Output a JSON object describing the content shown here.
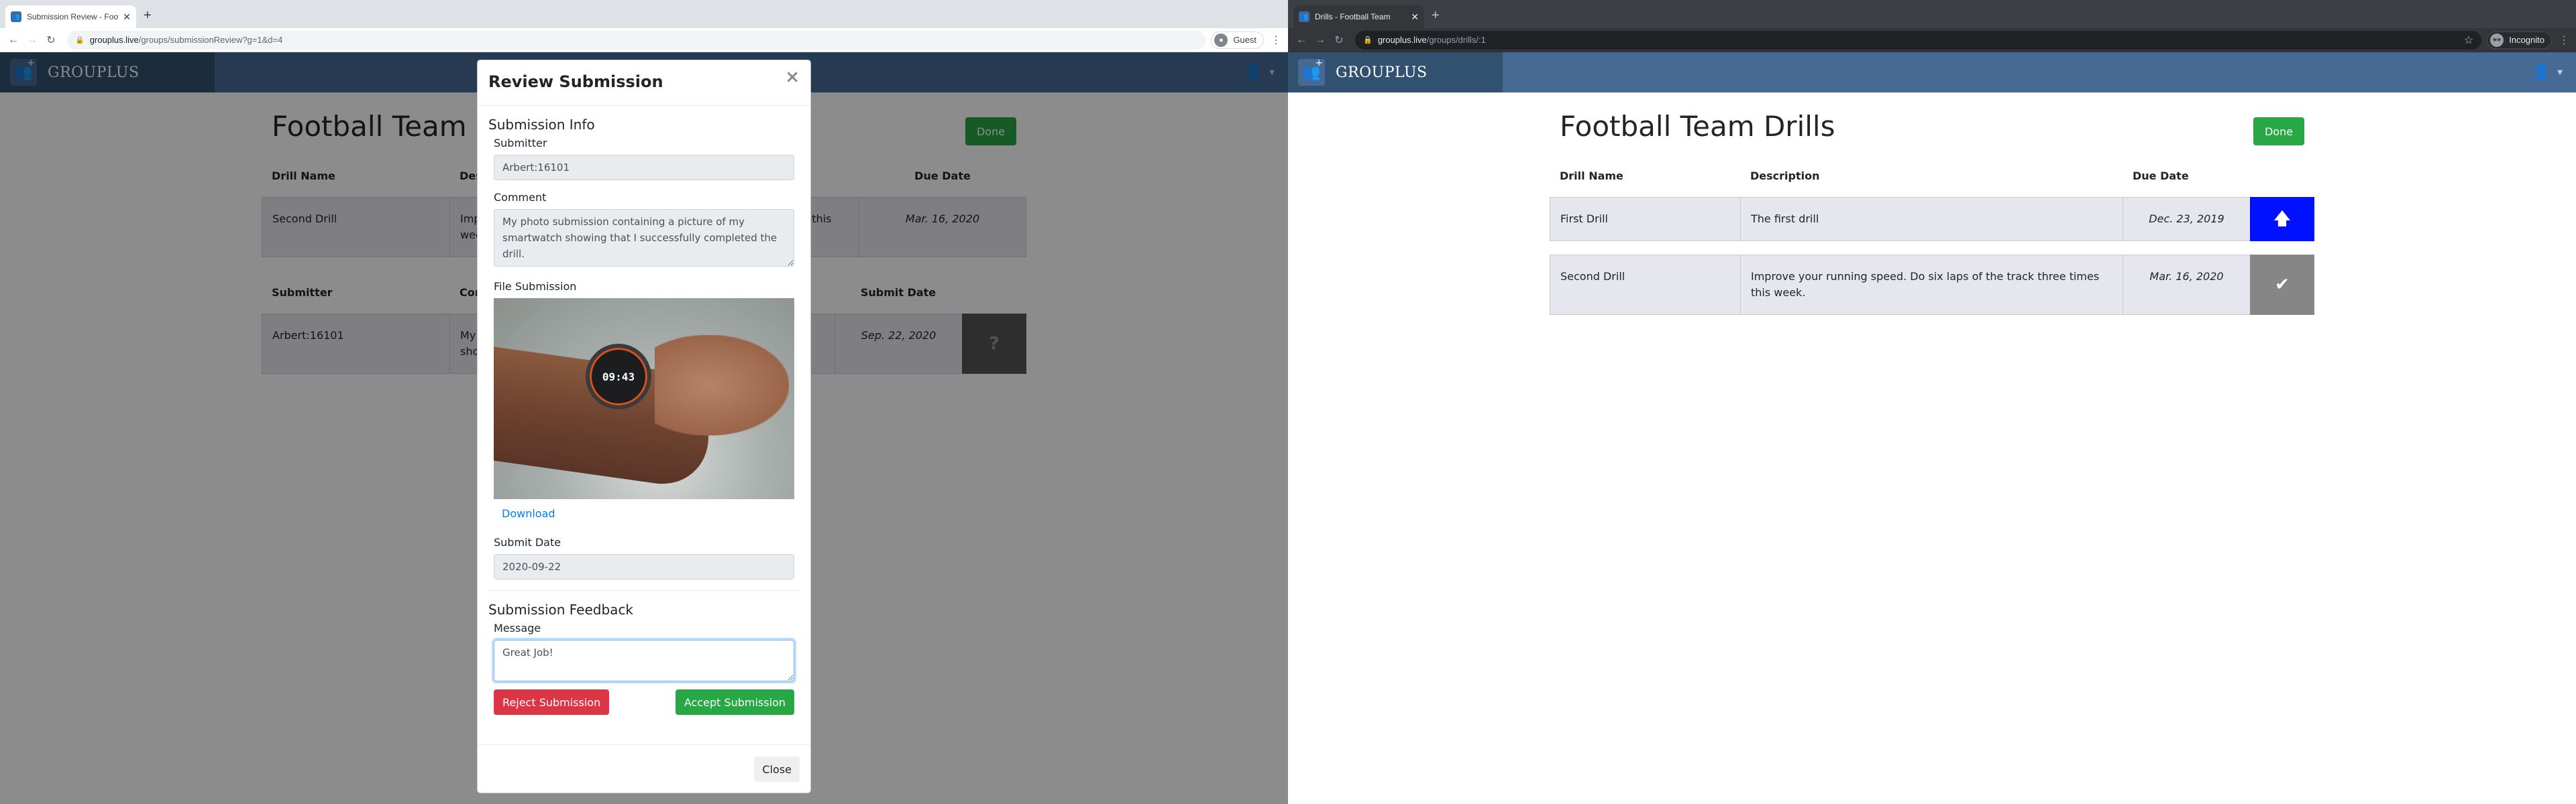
{
  "left_window": {
    "tab": {
      "title": "Submission Review - Football Team",
      "favicon": "grouplus-icon"
    },
    "url": {
      "host": "grouplus.live",
      "path": "/groups/submissionReview?g=1&d=4"
    },
    "profile": {
      "label": "Guest",
      "icon": "person-circle-icon"
    },
    "app": {
      "brand": "GROUPLUS",
      "page_title": "Football Team Drills",
      "done_label": "Done",
      "drill_table": {
        "headers": [
          "Drill Name",
          "Description",
          "Due Date"
        ],
        "rows": [
          {
            "name": "Second Drill",
            "description": "Improve your running speed. Do six laps of the track three times this week.",
            "due": "Mar. 16, 2020"
          }
        ]
      },
      "submission_table": {
        "headers": [
          "Submitter",
          "Comment",
          "Submit Date"
        ],
        "rows": [
          {
            "submitter": "Arbert:16101",
            "comment": "My photo submission containing a picture of my smartwatch showing that I successfully completed the drill.",
            "date": "Sep. 22, 2020",
            "status_icon": "?"
          }
        ]
      }
    },
    "modal": {
      "title": "Review Submission",
      "close_icon": "×",
      "info_section": "Submission Info",
      "submitter_label": "Submitter",
      "submitter_value": "Arbert:16101",
      "comment_label": "Comment",
      "comment_value": "My photo submission containing a picture of my smartwatch showing that I successfully completed the drill.",
      "file_label": "File Submission",
      "photo_time": "09:43",
      "download_label": "Download",
      "date_label": "Submit Date",
      "date_value": "2020-09-22",
      "feedback_section": "Submission Feedback",
      "message_label": "Message",
      "message_value": "Great Job!",
      "reject_label": "Reject Submission",
      "accept_label": "Accept Submission",
      "footer_close_label": "Close"
    }
  },
  "right_window": {
    "tab": {
      "title": "Drills - Football Team",
      "favicon": "grouplus-icon"
    },
    "url": {
      "host": "grouplus.live",
      "path": "/groups/drills/:1"
    },
    "profile": {
      "label": "Incognito",
      "icon": "incognito-icon"
    },
    "app": {
      "brand": "GROUPLUS",
      "page_title": "Football Team Drills",
      "done_label": "Done",
      "drill_table": {
        "headers": [
          "Drill Name",
          "Description",
          "Due Date"
        ],
        "rows": [
          {
            "name": "First Drill",
            "description": "The first drill",
            "due": "Dec. 23, 2019",
            "action_icon": "upload-arrow-icon",
            "action_glyph": "🡅",
            "action_color": "#0011ff"
          },
          {
            "name": "Second Drill",
            "description": "Improve your running speed. Do six laps of the track three times this week.",
            "due": "Mar. 16, 2020",
            "action_icon": "check-icon",
            "action_glyph": "✔",
            "action_color": "#868686"
          }
        ]
      }
    }
  },
  "colors": {
    "navbar": "#466a94",
    "brand_bg": "#32506f",
    "success": "#28a745",
    "danger": "#dc3545",
    "link": "#007bff"
  }
}
